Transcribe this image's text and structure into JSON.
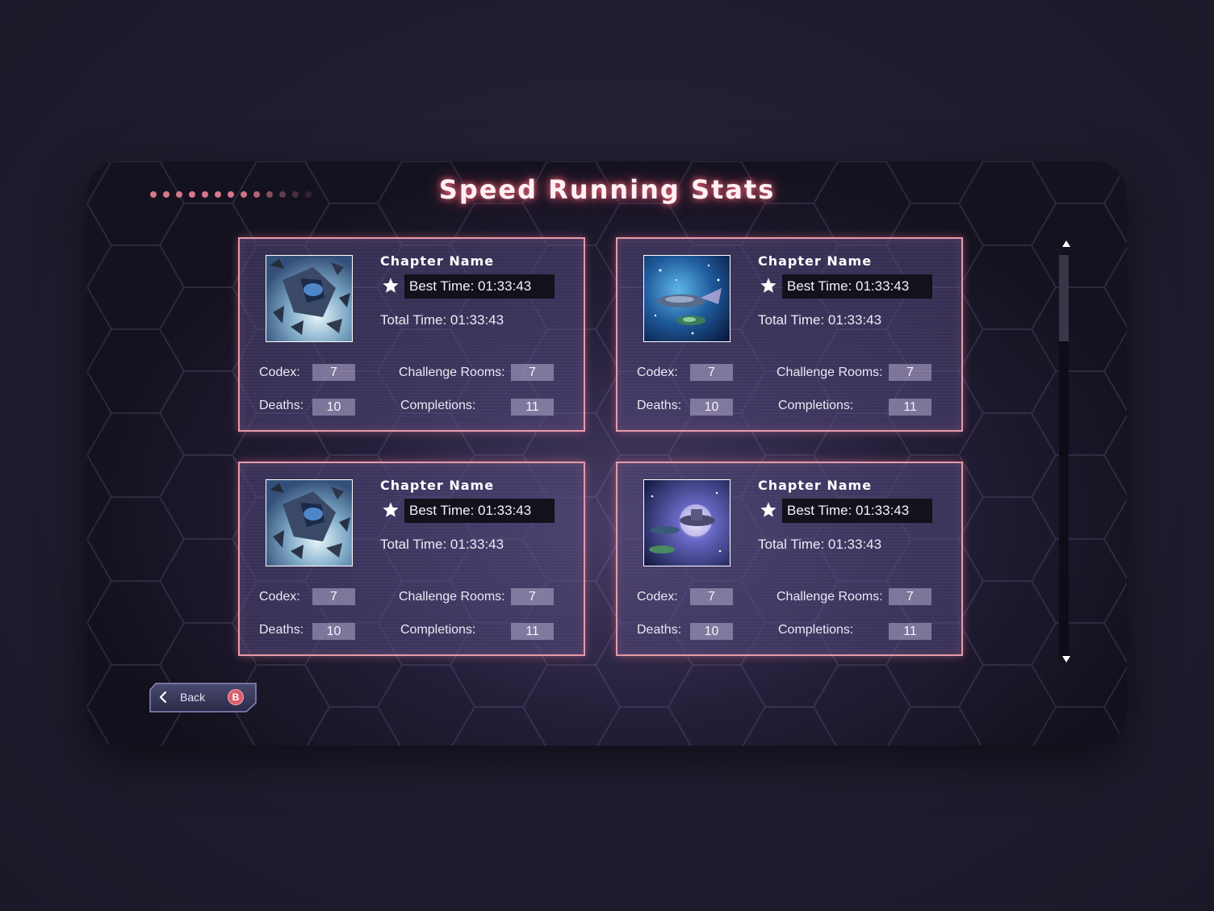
{
  "screen": {
    "title": "Speed Running Stats",
    "pager_dots": [
      1,
      1,
      1,
      1,
      1,
      1,
      1,
      0.95,
      0.8,
      0.6,
      0.42,
      0.28,
      0.16
    ]
  },
  "cards": [
    {
      "chapter_name": "Chapter Name",
      "best_time": "Best Time: 01:33:43",
      "total_time": "Total Time: 01:33:43",
      "codex_label": "Codex:",
      "codex": "7",
      "challenge_label": "Challenge Rooms:",
      "challenge_rooms": "7",
      "deaths_label": "Deaths:",
      "deaths": "10",
      "completions_label": "Completions:",
      "completions": "11",
      "thumbnail": "ship-debris-art"
    },
    {
      "chapter_name": "Chapter Name",
      "best_time": "Best Time: 01:33:43",
      "total_time": "Total Time: 01:33:43",
      "codex_label": "Codex:",
      "codex": "7",
      "challenge_label": "Challenge Rooms:",
      "challenge_rooms": "7",
      "deaths_label": "Deaths:",
      "deaths": "10",
      "completions_label": "Completions:",
      "completions": "11",
      "thumbnail": "ships-in-space-art"
    },
    {
      "chapter_name": "Chapter Name",
      "best_time": "Best Time: 01:33:43",
      "total_time": "Total Time: 01:33:43",
      "codex_label": "Codex:",
      "codex": "7",
      "challenge_label": "Challenge Rooms:",
      "challenge_rooms": "7",
      "deaths_label": "Deaths:",
      "deaths": "10",
      "completions_label": "Completions:",
      "completions": "11",
      "thumbnail": "ship-debris-art"
    },
    {
      "chapter_name": "Chapter Name",
      "best_time": "Best Time: 01:33:43",
      "total_time": "Total Time: 01:33:43",
      "codex_label": "Codex:",
      "codex": "7",
      "challenge_label": "Challenge Rooms:",
      "challenge_rooms": "7",
      "deaths_label": "Deaths:",
      "deaths": "10",
      "completions_label": "Completions:",
      "completions": "11",
      "thumbnail": "space-station-art"
    }
  ],
  "scrollbar": {
    "up_icon": "arrow-up-icon",
    "down_icon": "arrow-down-icon",
    "position": 0
  },
  "back_button": {
    "label": "Back",
    "icon": "chevron-left-icon",
    "controller_key": "B"
  },
  "colors": {
    "accent_pink": "#e79aa8",
    "title_glow": "#ff6e82",
    "card_fill": "#4e4678",
    "value_box": "#b4accd",
    "best_time_box": "#12111c",
    "b_button": "#d8606e"
  }
}
